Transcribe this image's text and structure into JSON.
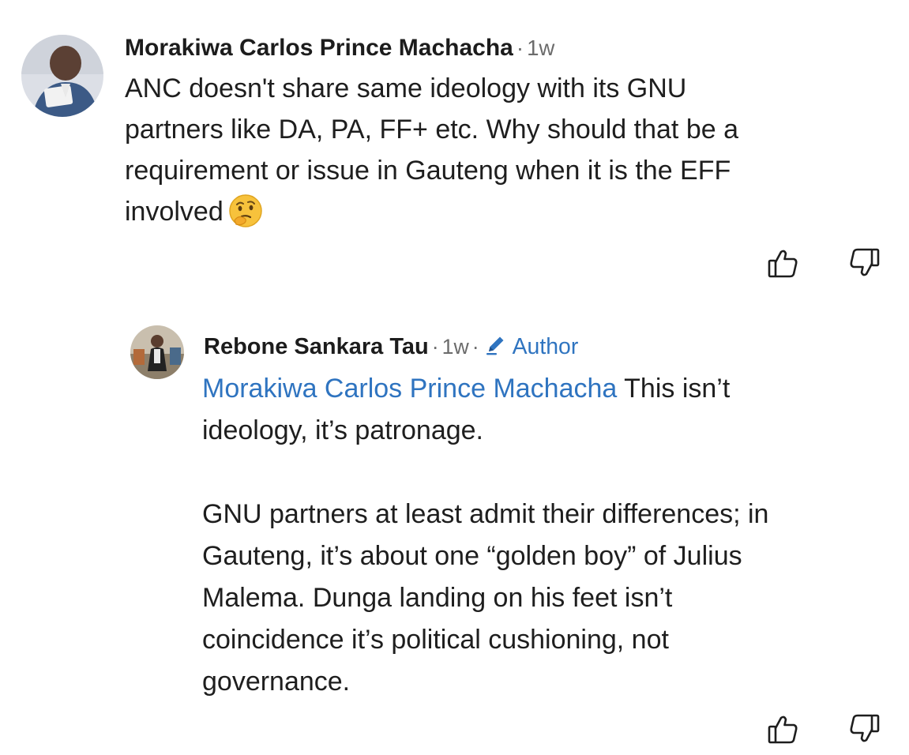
{
  "comments": [
    {
      "author": "Morakiwa Carlos Prince Machacha",
      "separator": "·",
      "time": "1w",
      "body": "ANC doesn't share same ideology with its GNU\npartners like DA, PA, FF+ etc. Why should that be a\nrequirement or issue in Gauteng when it is the EFF\ninvolved",
      "emoji": "thinking-face"
    },
    {
      "author": "Rebone Sankara Tau",
      "separator": "·",
      "time": "1w",
      "badge": "Author",
      "mention": "Morakiwa Carlos Prince Machacha",
      "body": " This isn’t\nideology, it’s patronage.\n\nGNU partners at least admit their differences; in\nGauteng, it’s about one “golden boy” of Julius\nMalema. Dunga landing on his feet isn’t\ncoincidence it’s political cushioning, not\ngovernance."
    }
  ],
  "icons": {
    "like": "thumbs-up-icon",
    "dislike": "thumbs-down-icon",
    "author_badge": "pencil-icon"
  },
  "colors": {
    "link": "#2f74c0",
    "meta": "#6b6b6b",
    "text": "#1e1e1e"
  }
}
